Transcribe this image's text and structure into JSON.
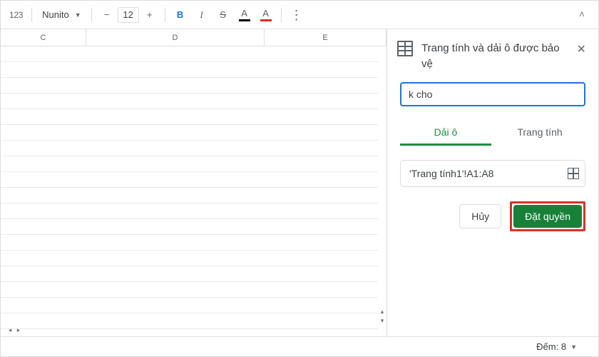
{
  "toolbar": {
    "format_123": "123",
    "font": "Nunito",
    "size": "12",
    "bold": "B",
    "italic": "I",
    "strike": "S",
    "text_color_letter": "A",
    "fill_color_letter": "A"
  },
  "sheet": {
    "columns": [
      "C",
      "D",
      "E"
    ],
    "row_count": 18
  },
  "sidepanel": {
    "title": "Trang tính và dải ô được bảo vệ",
    "description_value": "k cho",
    "tabs": {
      "range": "Dải ô",
      "sheet": "Trang tính"
    },
    "range_value": "'Trang tính1'!A1:A8",
    "actions": {
      "cancel": "Hủy",
      "set_permissions": "Đặt quyền"
    }
  },
  "statusbar": {
    "count_label": "Đếm: 8"
  }
}
